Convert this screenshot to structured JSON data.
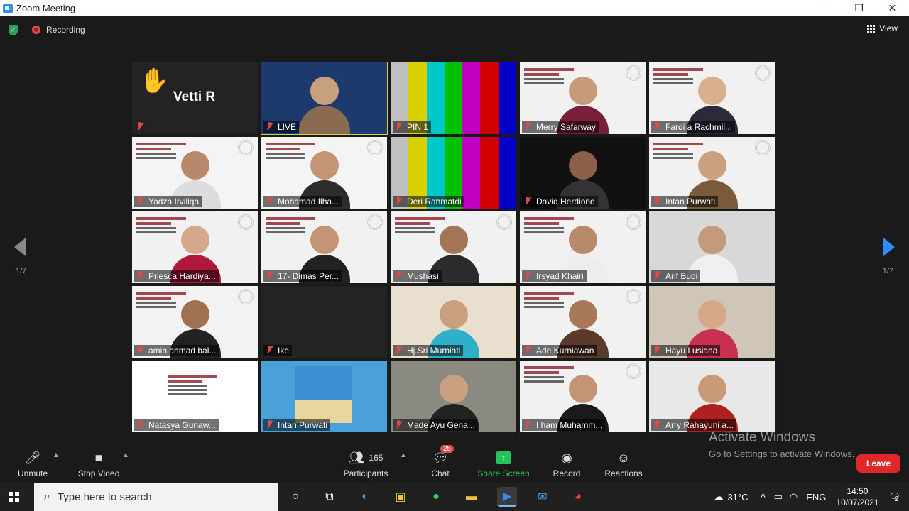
{
  "window": {
    "title": "Zoom Meeting",
    "minimize": "—",
    "maximize": "❐",
    "close": "✕"
  },
  "top": {
    "recording_label": "Recording",
    "view_label": "View"
  },
  "navigation": {
    "page_left": "1/7",
    "page_right": "1/7"
  },
  "tiles": [
    {
      "name": "Vetti R",
      "type": "avatar",
      "hand": "✋",
      "bg": "#232323"
    },
    {
      "name": "LIVE",
      "type": "live",
      "bg": "#1d3a6d"
    },
    {
      "name": "PIN 1",
      "type": "bars",
      "bg": "#000"
    },
    {
      "name": "Merry Safarway",
      "type": "person",
      "bg": "#f1f1f1",
      "skin": "#c89a7c",
      "cloth": "#7a1f3a"
    },
    {
      "name": "Fardi a Rachmil...",
      "type": "person",
      "bg": "#f1f1f1",
      "skin": "#d9b08e",
      "cloth": "#2a2a3a"
    },
    {
      "name": "Yadza Irviliqa",
      "type": "person",
      "bg": "#f4f4f4",
      "skin": "#b7896a",
      "cloth": "#ddd"
    },
    {
      "name": "Mohamad Ilha...",
      "type": "person",
      "bg": "#f4f4f4",
      "skin": "#c49474",
      "cloth": "#2c2c2c"
    },
    {
      "name": "Deri Rahmatdi",
      "type": "bars",
      "bg": "#000"
    },
    {
      "name": "David Herdiono",
      "type": "person",
      "bg": "#101010",
      "skin": "#8a6048",
      "cloth": "#333"
    },
    {
      "name": "Intan Purwati",
      "type": "person",
      "bg": "#f1f1f1",
      "skin": "#caa07e",
      "cloth": "#7a5a3a"
    },
    {
      "name": "Priesca Hardiya...",
      "type": "person",
      "bg": "#f1f1f1",
      "skin": "#d5a88a",
      "cloth": "#b0193c"
    },
    {
      "name": "17- Dimas Per...",
      "type": "person",
      "bg": "#f1f1f1",
      "skin": "#c49474",
      "cloth": "#222"
    },
    {
      "name": "Mushasi",
      "type": "person",
      "bg": "#f1f1f1",
      "skin": "#a47455",
      "cloth": "#2b2b2b"
    },
    {
      "name": "Irsyad Khairi",
      "type": "person",
      "bg": "#f1f1f1",
      "skin": "#b98a6a",
      "cloth": "#eee"
    },
    {
      "name": "Arif Budi",
      "type": "person",
      "bg": "#d8d8d8",
      "skin": "#c59a7a",
      "cloth": "#f0f0f0"
    },
    {
      "name": "amin ahmad bal...",
      "type": "person",
      "bg": "#f2f2f2",
      "skin": "#a07050",
      "cloth": "#222"
    },
    {
      "name": "Ike",
      "type": "empty",
      "bg": "#232323"
    },
    {
      "name": "Hj.Sri Murniati",
      "type": "person",
      "bg": "#e8dfcf",
      "skin": "#c9a07e",
      "cloth": "#2db0c8"
    },
    {
      "name": "Ade Kurniawan",
      "type": "person",
      "bg": "#f1f1f1",
      "skin": "#a87858",
      "cloth": "#5a3a2a"
    },
    {
      "name": "Hayu Lusiana",
      "type": "person",
      "bg": "#cfc6b8",
      "skin": "#d7a888",
      "cloth": "#c83050"
    },
    {
      "name": "Natasya Gunaw...",
      "type": "slide",
      "bg": "#ffffff"
    },
    {
      "name": "Intan Purwati",
      "type": "photo",
      "bg": "#4aa0d8"
    },
    {
      "name": "Made Ayu Gena...",
      "type": "person",
      "bg": "#8a8a80",
      "skin": "#caa080",
      "cloth": "#222"
    },
    {
      "name": "I ham Muhamm...",
      "type": "person",
      "bg": "#f1f1f1",
      "skin": "#c49474",
      "cloth": "#1a1a1a"
    },
    {
      "name": "Arry Rahayuni a...",
      "type": "person",
      "bg": "#e8e8e8",
      "skin": "#c99a78",
      "cloth": "#b02020"
    }
  ],
  "toolbar": {
    "unmute": "Unmute",
    "stop_video": "Stop Video",
    "participants_count": "165",
    "participants": "Participants",
    "chat": "Chat",
    "chat_badge": "25",
    "share_screen": "Share Screen",
    "record": "Record",
    "reactions": "Reactions",
    "leave": "Leave"
  },
  "watermark": {
    "line1": "Activate Windows",
    "line2": "Go to Settings to activate Windows."
  },
  "taskbar": {
    "search_placeholder": "Type here to search",
    "temperature": "31°C",
    "language": "ENG",
    "time": "14:50",
    "date": "10/07/2021",
    "notifications": "2"
  }
}
